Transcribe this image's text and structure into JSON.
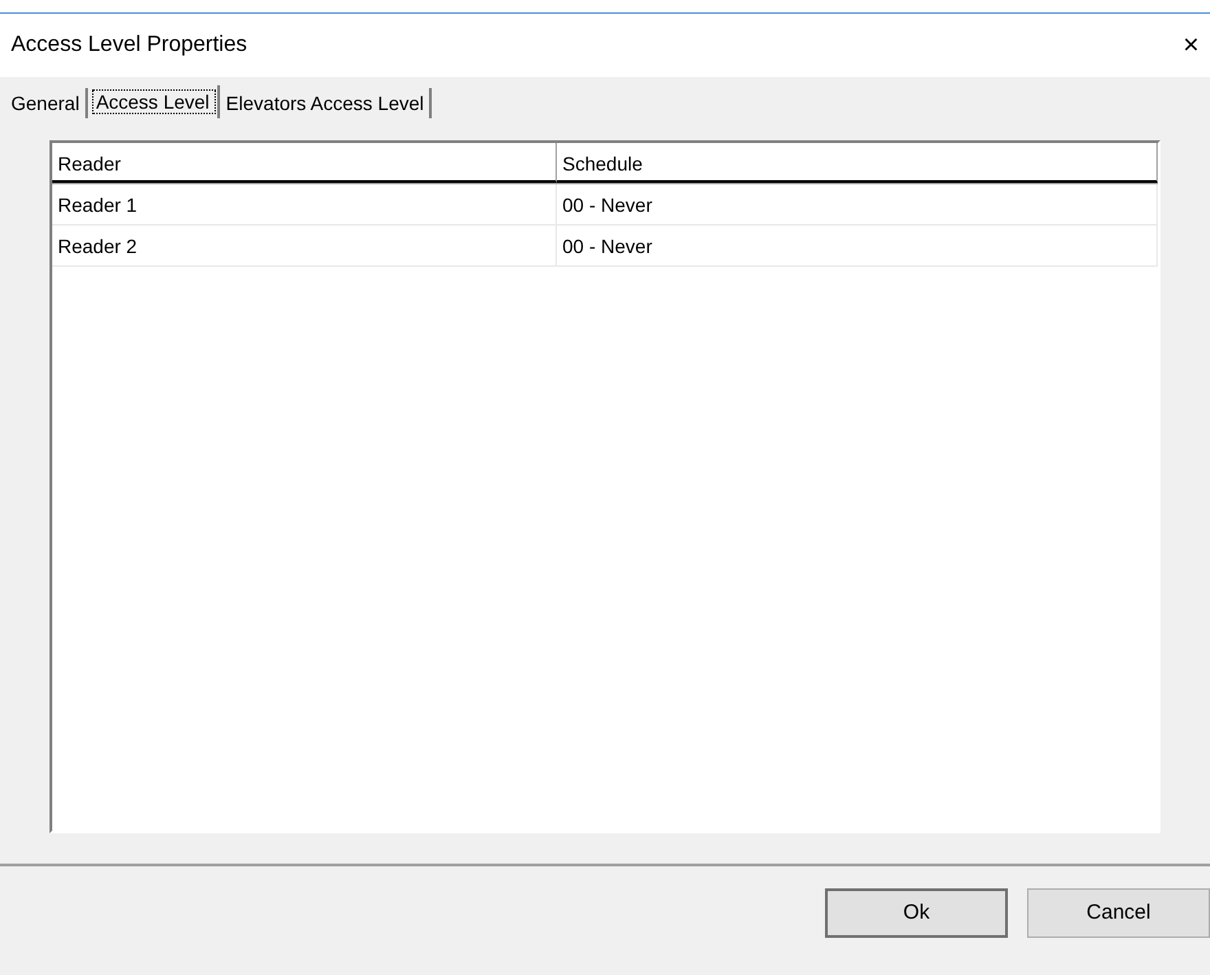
{
  "window": {
    "title": "Access Level Properties",
    "close": "×"
  },
  "tabs": [
    {
      "label": "General",
      "selected": false
    },
    {
      "label": "Access Level",
      "selected": true
    },
    {
      "label": "Elevators Access Level",
      "selected": false
    }
  ],
  "table": {
    "columns": [
      "Reader",
      "Schedule"
    ],
    "rows": [
      [
        "Reader 1",
        "00 - Never"
      ],
      [
        "Reader 2",
        "00 - Never"
      ]
    ]
  },
  "buttons": [
    {
      "label": "Ok",
      "default": true
    },
    {
      "label": "Cancel",
      "default": false
    }
  ]
}
